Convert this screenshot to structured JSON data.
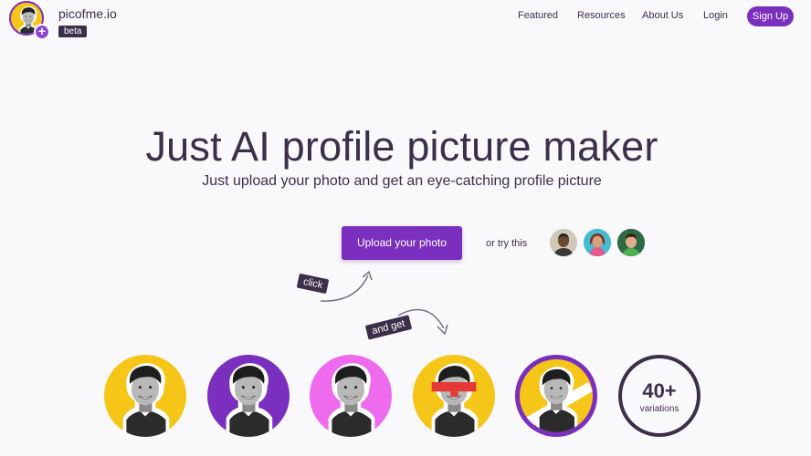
{
  "header": {
    "brand": "picofme.io",
    "badge": "beta",
    "nav": [
      "Featured",
      "Resources",
      "About Us",
      "Login"
    ],
    "signup_label": "Sign Up"
  },
  "hero": {
    "title": "Just AI profile picture maker",
    "subtitle": "Just upload your photo and get an eye-catching profile picture"
  },
  "actions": {
    "upload_label": "Upload your photo",
    "try_label": "or try this"
  },
  "annotations": {
    "click": "click",
    "and_get": "and get"
  },
  "variations": {
    "count": "40+",
    "label": "variations"
  },
  "colors": {
    "brand_purple": "#7b2fbf",
    "dark": "#3c2f4a",
    "yellow": "#f5c518",
    "magenta": "#ee6bee",
    "background": "#f9f8fb"
  }
}
